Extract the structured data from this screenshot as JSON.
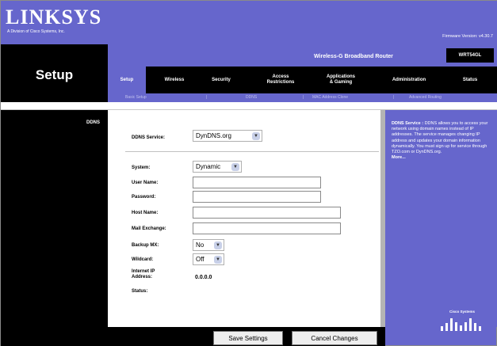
{
  "header": {
    "logo": "LINKSYS",
    "logo_sub": "A Division of Cisco Systems, Inc.",
    "firmware": "Firmware Version: v4.30.7"
  },
  "productbar": {
    "product_name": "Wireless-G Broadband Router",
    "model": "WRT54GL"
  },
  "page": {
    "section_title": "Setup",
    "left_label": "DDNS"
  },
  "tabs": [
    {
      "label": "Setup",
      "active": true
    },
    {
      "label": "Wireless"
    },
    {
      "label": "Security"
    },
    {
      "label": "Access\nRestrictions"
    },
    {
      "label": "Applications\n& Gaming"
    },
    {
      "label": "Administration"
    },
    {
      "label": "Status"
    }
  ],
  "subtabs": [
    "Basic Setup",
    "DDNS",
    "MAC Address Clone",
    "Advanced Routing"
  ],
  "form": {
    "ddns_service_label": "DDNS Service:",
    "ddns_service_value": "DynDNS.org",
    "system_label": "System:",
    "system_value": "Dynamic",
    "username_label": "User Name:",
    "username_value": "",
    "password_label": "Password:",
    "password_value": "",
    "hostname_label": "Host Name:",
    "hostname_value": "",
    "mail_exchange_label": "Mail Exchange:",
    "mail_exchange_value": "",
    "backup_mx_label": "Backup MX:",
    "backup_mx_value": "No",
    "wildcard_label": "Wildcard:",
    "wildcard_value": "Off",
    "internet_ip_label": "Internet IP Address:",
    "internet_ip_value": "0.0.0.0",
    "status_label": "Status:",
    "status_value": ""
  },
  "help": {
    "title": "DDNS Service :",
    "body": "DDNS allows you to access your network using domain names instead of IP addresses. The service manages changing IP address and updates your domain information dynamically. You must sign up for service through TZO.com or DynDNS.org.",
    "more": "More..."
  },
  "buttons": {
    "save": "Save Settings",
    "cancel": "Cancel Changes"
  },
  "footer": {
    "cisco_logo": "Cisco Systems"
  },
  "colors": {
    "brand_purple": "#6666cc",
    "black": "#000000",
    "subtab_text": "#c0c0ee"
  }
}
